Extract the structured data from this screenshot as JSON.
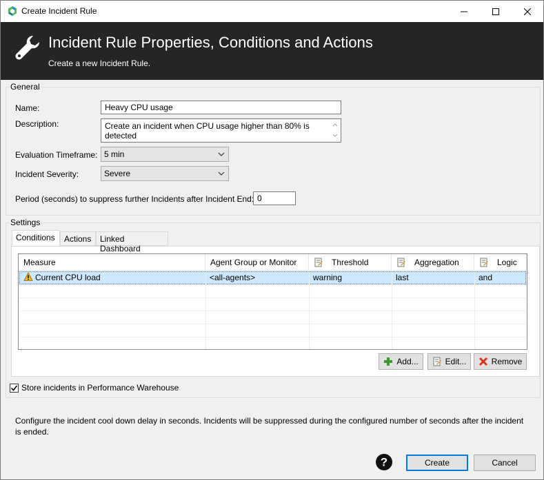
{
  "window": {
    "title": "Create Incident Rule"
  },
  "banner": {
    "title": "Incident Rule Properties, Conditions and Actions",
    "subtitle": "Create a new Incident Rule."
  },
  "general": {
    "legend": "General",
    "name_label": "Name:",
    "name_value": "Heavy CPU usage",
    "description_label": "Description:",
    "description_value": "Create an incident when CPU usage higher than 80% is detected",
    "timeframe_label": "Evaluation Timeframe:",
    "timeframe_value": "5 min",
    "severity_label": "Incident Severity:",
    "severity_value": "Severe",
    "suppress_label": "Period (seconds) to suppress further Incidents after Incident End:",
    "suppress_value": "0"
  },
  "settings": {
    "legend": "Settings",
    "tabs": [
      {
        "label": "Conditions",
        "active": true
      },
      {
        "label": "Actions",
        "active": false
      },
      {
        "label": "Linked Dashboard",
        "active": false
      }
    ],
    "table": {
      "columns": [
        "Measure",
        "Agent Group or Monitor",
        "Threshold",
        "Aggregation",
        "Logic"
      ],
      "rows": [
        {
          "measure": "Current CPU load",
          "agent_group": "<all-agents>",
          "threshold": "warning",
          "aggregation": "last",
          "logic": "and"
        }
      ]
    },
    "buttons": {
      "add": "Add...",
      "edit": "Edit...",
      "remove": "Remove"
    },
    "store_label": "Store incidents in Performance Warehouse",
    "store_checked": true
  },
  "footer": {
    "info": "Configure the incident cool down delay in seconds. Incidents will be suppressed during the configured number of seconds after the incident is ended.",
    "create_label": "Create",
    "cancel_label": "Cancel"
  },
  "colors": {
    "banner_bg": "#252526",
    "selection": "#cde8ff",
    "primary_border": "#0078d7"
  }
}
